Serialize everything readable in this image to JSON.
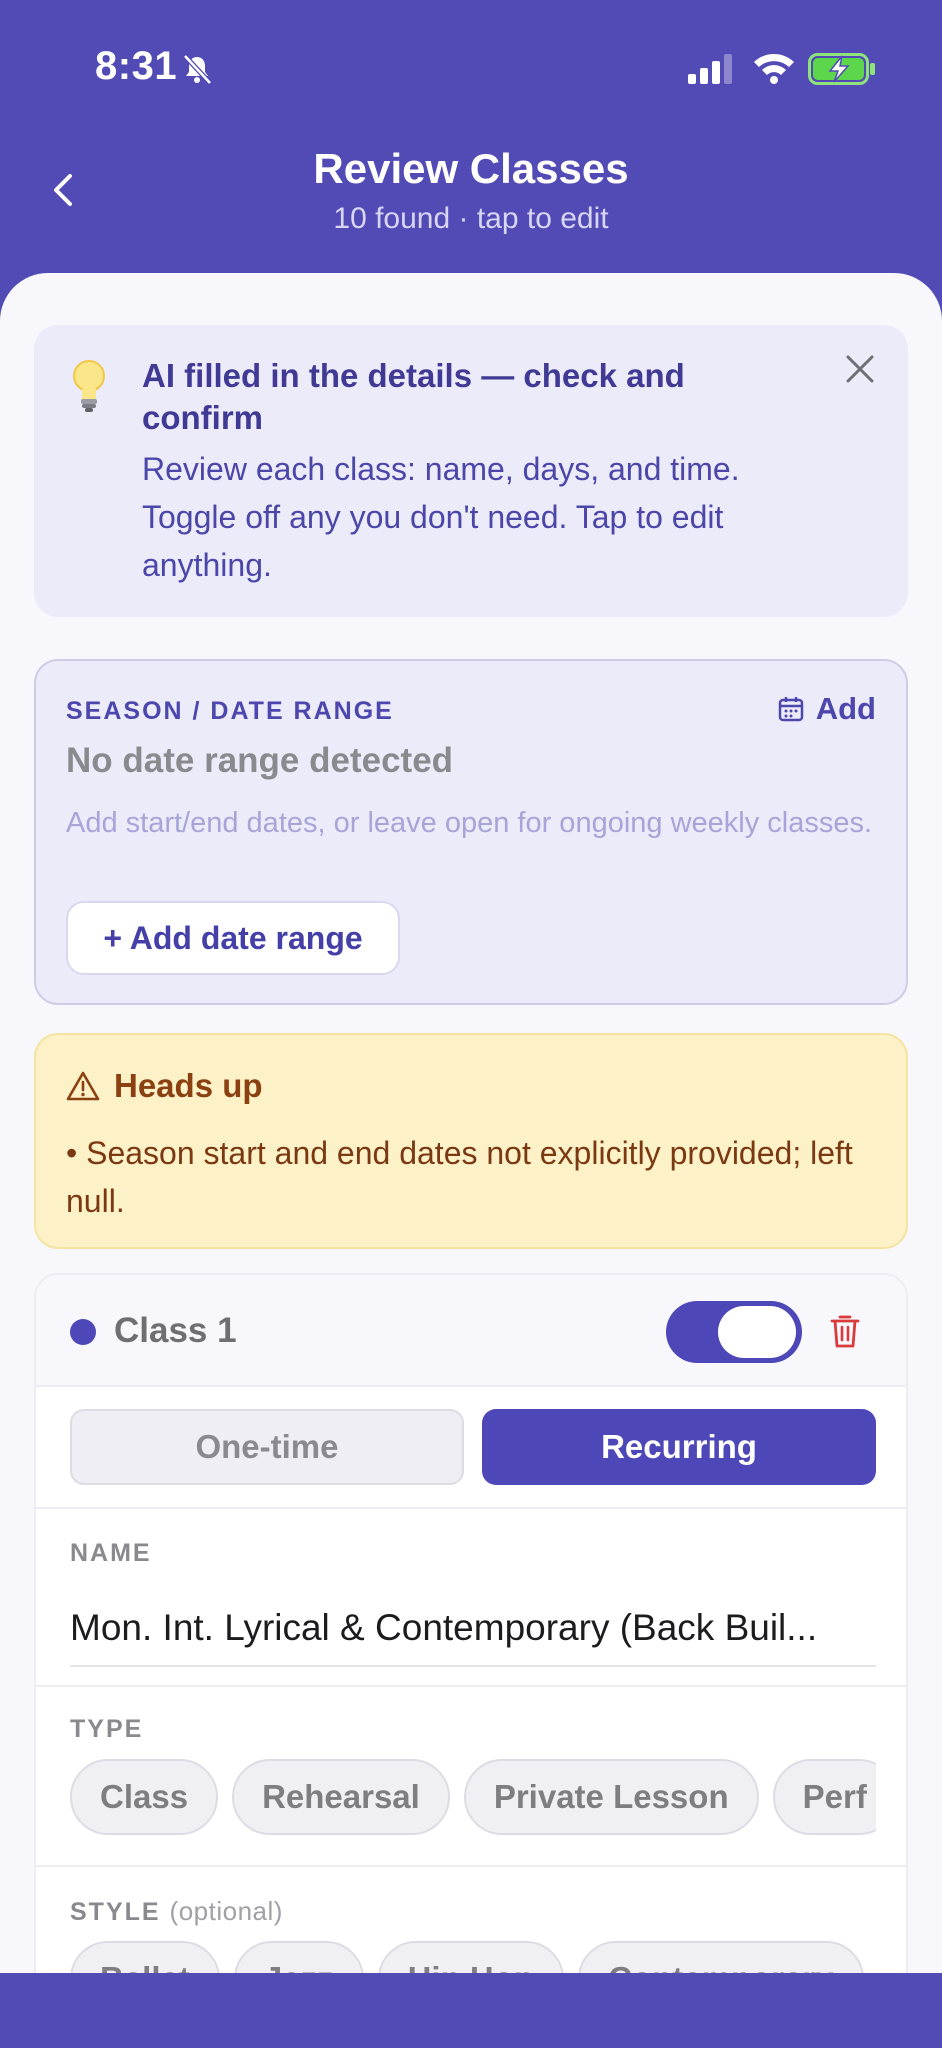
{
  "status_bar": {
    "time": "8:31"
  },
  "header": {
    "title": "Review Classes",
    "subtitle": "10 found · tap to edit"
  },
  "info_banner": {
    "title": "AI filled in the details — check and confirm",
    "body": "Review each class: name, days, and time. Toggle off any you don't need. Tap to edit anything."
  },
  "season": {
    "label": "SEASON / DATE RANGE",
    "add_label": "Add",
    "status": "No date range detected",
    "hint": "Add start/end dates, or leave open for ongoing weekly classes.",
    "button_label": "+ Add date range"
  },
  "warning": {
    "title": "Heads up",
    "body": "• Season start and end dates not explicitly provided; left null."
  },
  "class_card": {
    "title": "Class 1",
    "enabled": true,
    "segments": {
      "one_time": "One-time",
      "recurring": "Recurring",
      "selected": "Recurring"
    },
    "name_label": "NAME",
    "name_value": "Mon. Int. Lyrical & Contemporary (Back Buil...",
    "type_label": "TYPE",
    "types": [
      "Class",
      "Rehearsal",
      "Private Lesson",
      "Perf"
    ],
    "style_label": "STYLE",
    "style_optional": "(optional)",
    "styles": [
      "Ballet",
      "Jazz",
      "Hip Hop",
      "Contemporary"
    ]
  },
  "colors": {
    "brand": "#524bb6",
    "accent": "#4d47b8",
    "warning_bg": "#fdf1c7",
    "danger": "#d93a3a"
  }
}
